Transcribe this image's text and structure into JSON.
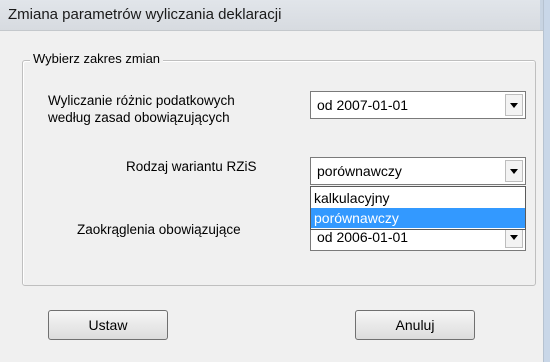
{
  "window": {
    "title": "Zmiana parametrów wyliczania deklaracji"
  },
  "group": {
    "legend": "Wybierz zakres zmian",
    "row1": {
      "label_line1": "Wyliczanie różnic podatkowych",
      "label_line2": "według zasad obowiązujących",
      "value": "od 2007-01-01"
    },
    "row2": {
      "label": "Rodzaj wariantu RZiS",
      "value": "porównawczy",
      "options": [
        "kalkulacyjny",
        "porównawczy"
      ],
      "selected_index": 1
    },
    "row3": {
      "label": "Zaokrąglenia obowiązujące",
      "value": "od 2006-01-01"
    }
  },
  "buttons": {
    "set": "Ustaw",
    "cancel": "Anuluj"
  },
  "colors": {
    "selection": "#3399ff",
    "titlebar": "#dfe3e8"
  }
}
